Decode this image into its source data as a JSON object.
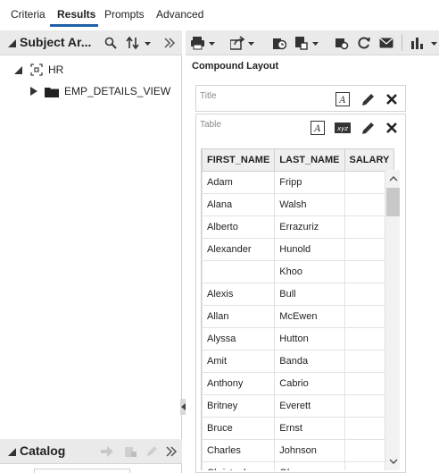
{
  "tabs": [
    "Criteria",
    "Results",
    "Prompts",
    "Advanced"
  ],
  "subject_area": {
    "title": "Subject Ar...",
    "root": "HR",
    "child": "EMP_DETAILS_VIEW"
  },
  "catalog": {
    "title": "Catalog"
  },
  "compound_layout": {
    "title": "Compound Layout"
  },
  "views": {
    "title_label": "Title",
    "table_label": "Table"
  },
  "table": {
    "columns": [
      "FIRST_NAME",
      "LAST_NAME",
      "SALARY"
    ],
    "rows": [
      [
        "Adam",
        "Fripp",
        ""
      ],
      [
        "Alana",
        "Walsh",
        ""
      ],
      [
        "Alberto",
        "Errazuriz",
        ""
      ],
      [
        "Alexander",
        "Hunold",
        ""
      ],
      [
        "",
        "Khoo",
        ""
      ],
      [
        "Alexis",
        "Bull",
        ""
      ],
      [
        "Allan",
        "McEwen",
        ""
      ],
      [
        "Alyssa",
        "Hutton",
        ""
      ],
      [
        "Amit",
        "Banda",
        ""
      ],
      [
        "Anthony",
        "Cabrio",
        ""
      ],
      [
        "Britney",
        "Everett",
        ""
      ],
      [
        "Bruce",
        "Ernst",
        ""
      ],
      [
        "Charles",
        "Johnson",
        ""
      ],
      [
        "Christopher",
        "Olsen",
        ""
      ]
    ]
  },
  "icons": {
    "view_format": "A",
    "xyz_format": "xyz"
  },
  "colors": {
    "tab_accent": "#1f5fa8",
    "header_bg": "#eaeaea"
  }
}
